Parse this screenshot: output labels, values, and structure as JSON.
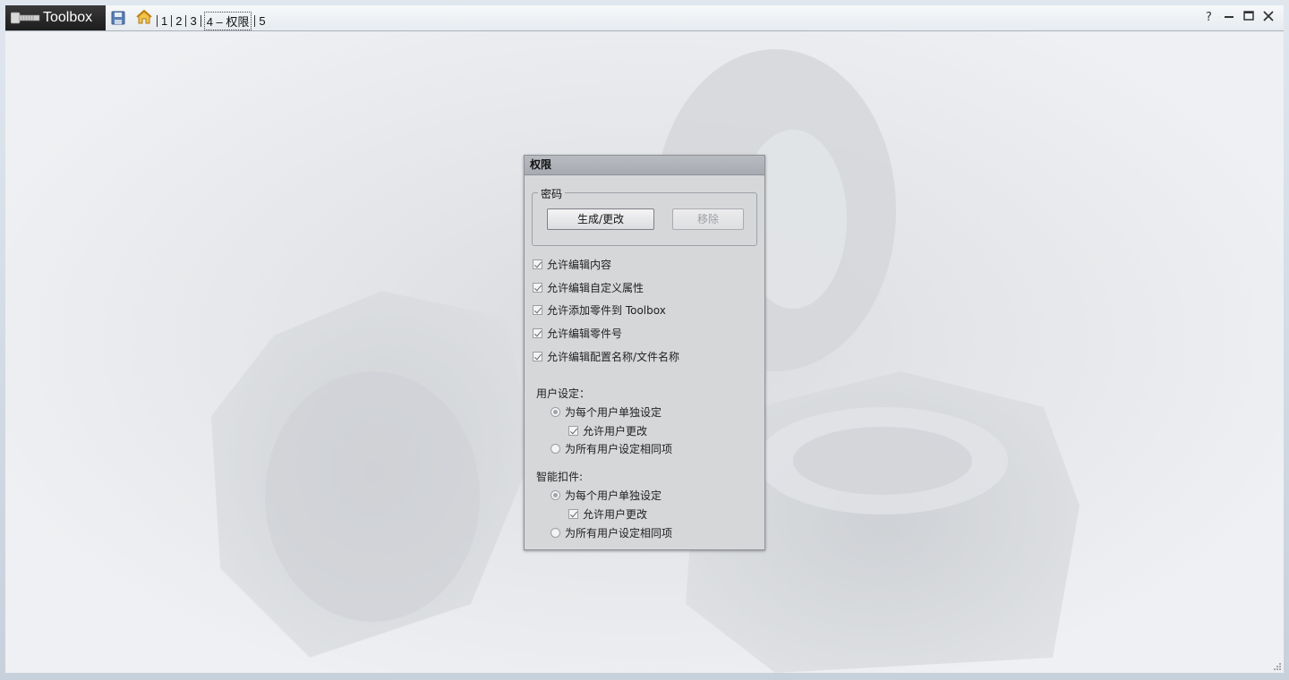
{
  "app": {
    "name": "Toolbox"
  },
  "breadcrumb": {
    "items": [
      "1",
      "2",
      "3",
      "4",
      "权限",
      "5"
    ],
    "active_index": 4
  },
  "icons": {
    "logo": "toolbox-bolt-icon",
    "save": "save-disk-icon",
    "home": "home-icon",
    "help": "help-icon",
    "minimize": "minimize-icon",
    "maximize": "maximize-icon",
    "close": "close-icon"
  },
  "panel": {
    "title": "权限",
    "password_group": {
      "legend": "密码",
      "generate_label": "生成/更改",
      "remove_label": "移除"
    },
    "options": [
      {
        "label": "允许编辑内容",
        "checked": true
      },
      {
        "label": "允许编辑自定义属性",
        "checked": true
      },
      {
        "label": "允许添加零件到 Toolbox",
        "checked": true
      },
      {
        "label": "允许编辑零件号",
        "checked": true
      },
      {
        "label": "允许编辑配置名称/文件名称",
        "checked": true
      }
    ],
    "user_settings": {
      "label": "用户设定：",
      "per_user": "为每个用户单独设定",
      "allow_change": "允许用户更改",
      "same_for_all": "为所有用户设定相同项"
    },
    "smart_fasteners": {
      "label": "智能扣件:",
      "per_user": "为每个用户单独设定",
      "allow_change": "允许用户更改",
      "same_for_all": "为所有用户设定相同项"
    }
  },
  "colors": {
    "title_tag": "#1c1c1c",
    "panel_header": "#a7abb1",
    "panel_bg": "#d6d7d9"
  }
}
